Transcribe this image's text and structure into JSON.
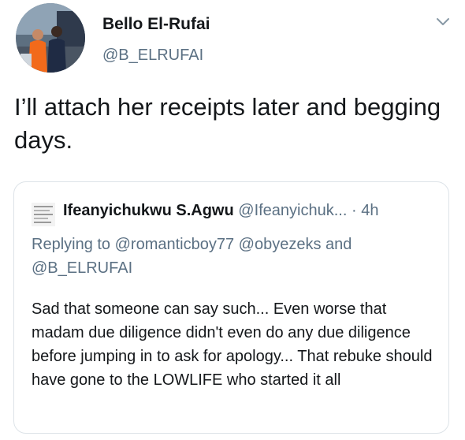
{
  "tweet": {
    "author": {
      "display_name": "Bello El-Rufai",
      "handle": "@B_ELRUFAI",
      "avatar_icon": "profile-photo"
    },
    "menu_icon": "chevron-down-icon",
    "text": "I’ll attach her receipts later and begging days."
  },
  "quoted_tweet": {
    "author": {
      "display_name": "Ifeanyichukwu S.Agwu",
      "handle": "@Ifeanyichuk...",
      "avatar_icon": "document-thumbnail"
    },
    "separator": "·",
    "time": "4h",
    "replying_to_prefix": "Replying to",
    "replying_to": [
      "@romanticboy77",
      "@obyezeks",
      "@B_ELRUFAI"
    ],
    "replying_and": "and",
    "text": "Sad that someone can say such... Even worse that madam due diligence didn't even do any due diligence before jumping in to ask for apology... That rebuke should have gone to the LOWLIFE who started it all"
  },
  "colors": {
    "text_primary": "#14171a",
    "text_secondary": "#5b7083",
    "border": "#dde3e8"
  }
}
